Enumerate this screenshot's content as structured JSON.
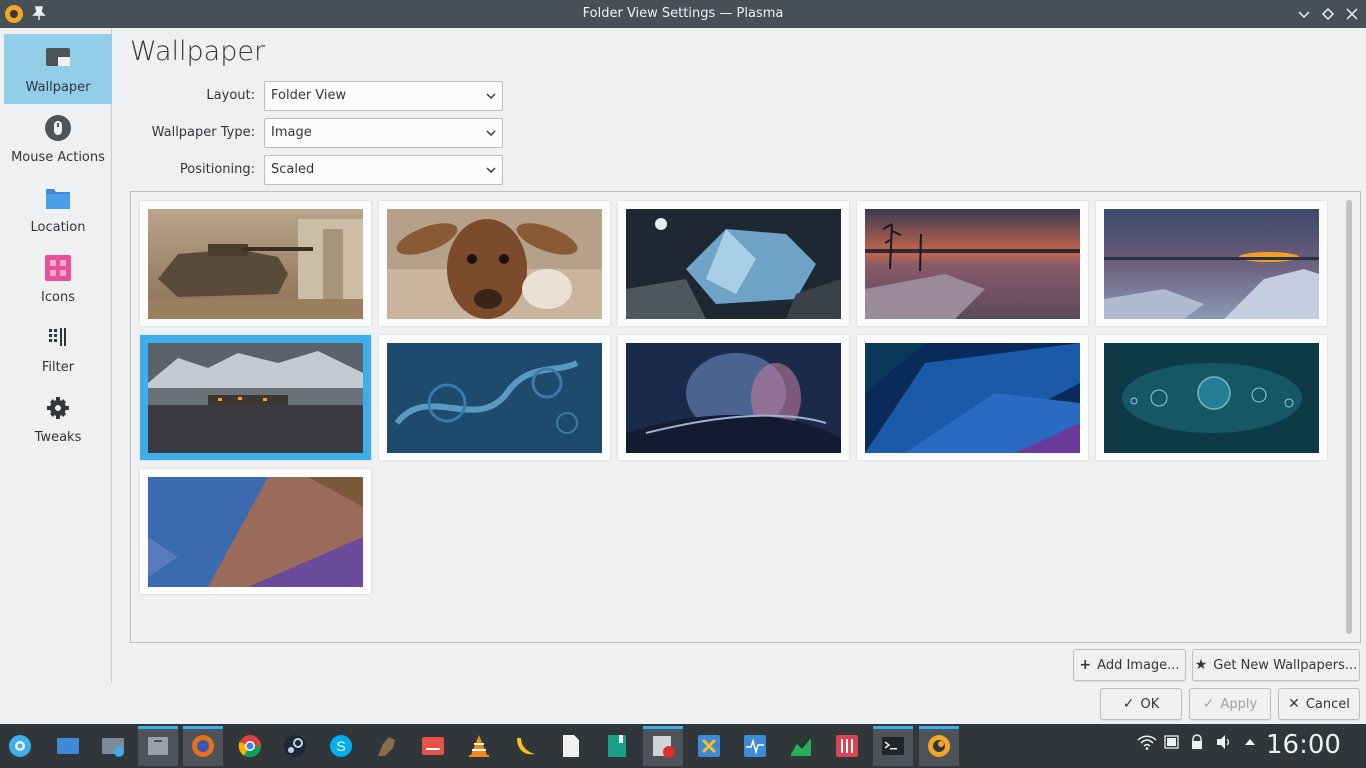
{
  "window": {
    "title": "Folder View Settings — Plasma"
  },
  "sidebar": {
    "items": [
      {
        "label": "Wallpaper",
        "icon": "wallpaper-icon",
        "active": true
      },
      {
        "label": "Mouse Actions",
        "icon": "mouse-icon"
      },
      {
        "label": "Location",
        "icon": "folder-icon"
      },
      {
        "label": "Icons",
        "icon": "icons-grid-icon"
      },
      {
        "label": "Filter",
        "icon": "filter-icon"
      },
      {
        "label": "Tweaks",
        "icon": "gear-icon"
      }
    ]
  },
  "main": {
    "title": "Wallpaper",
    "layout_label": "Layout:",
    "layout_value": "Folder View",
    "type_label": "Wallpaper Type:",
    "type_value": "Image",
    "positioning_label": "Positioning:",
    "positioning_value": "Scaled"
  },
  "gallery": {
    "selected_index": 5,
    "items": [
      {
        "name": "tank",
        "icon": "wallpaper-tank"
      },
      {
        "name": "goat",
        "icon": "wallpaper-goat"
      },
      {
        "name": "ice-rock",
        "icon": "wallpaper-ice"
      },
      {
        "name": "sunset-tree",
        "icon": "wallpaper-sunset-tree"
      },
      {
        "name": "winter-sunset",
        "icon": "wallpaper-winter-sunset"
      },
      {
        "name": "fjord-village",
        "icon": "wallpaper-fjord"
      },
      {
        "name": "blue-swirls",
        "icon": "wallpaper-swirls"
      },
      {
        "name": "aurora-wave",
        "icon": "wallpaper-aurora"
      },
      {
        "name": "blue-abstract",
        "icon": "wallpaper-blue-abstract"
      },
      {
        "name": "teal-bubbles",
        "icon": "wallpaper-bubbles"
      },
      {
        "name": "purple-geometry",
        "icon": "wallpaper-geometry"
      }
    ]
  },
  "actions": {
    "add_image": "Add Image...",
    "get_new": "Get New Wallpapers...",
    "ok": "OK",
    "apply": "Apply",
    "cancel": "Cancel"
  },
  "taskbar": {
    "clock": "16:00",
    "apps": [
      "plasma-menu",
      "show-desktop",
      "screenshot",
      "file-manager",
      "firefox",
      "chrome",
      "steam",
      "skype",
      "gimp",
      "presentation",
      "vlc",
      "banana",
      "document",
      "book",
      "kolourpaint",
      "cantor",
      "system-monitor",
      "chart-app",
      "mixer",
      "terminal",
      "amarok"
    ],
    "tray": [
      "wifi-icon",
      "battery-icon",
      "lock-icon",
      "volume-icon",
      "tray-expand-icon"
    ]
  }
}
